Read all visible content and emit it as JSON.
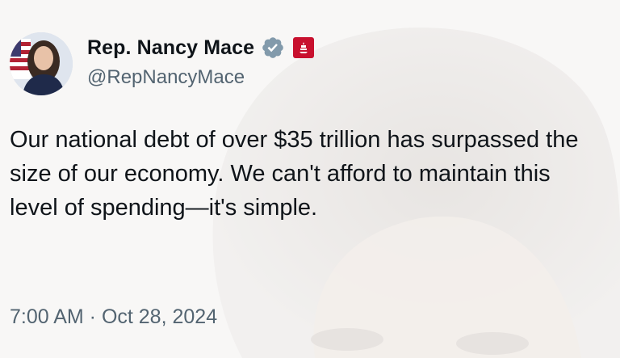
{
  "tweet": {
    "author": {
      "display_name": "Rep. Nancy Mace",
      "handle": "@RepNancyMace",
      "verified_icon": "verified-badge-icon",
      "affiliation_icon": "us-house-seal-icon"
    },
    "text": "Our national debt of over $35 trillion has surpassed the size of our economy. We can't afford to maintain this level of spending—it's simple.",
    "timestamp": "7:00 AM · Oct 28, 2024"
  },
  "colors": {
    "primary_text": "#0f1419",
    "secondary_text": "#536471",
    "verified_badge": "#829aab",
    "affiliation_badge": "#c8102e"
  }
}
